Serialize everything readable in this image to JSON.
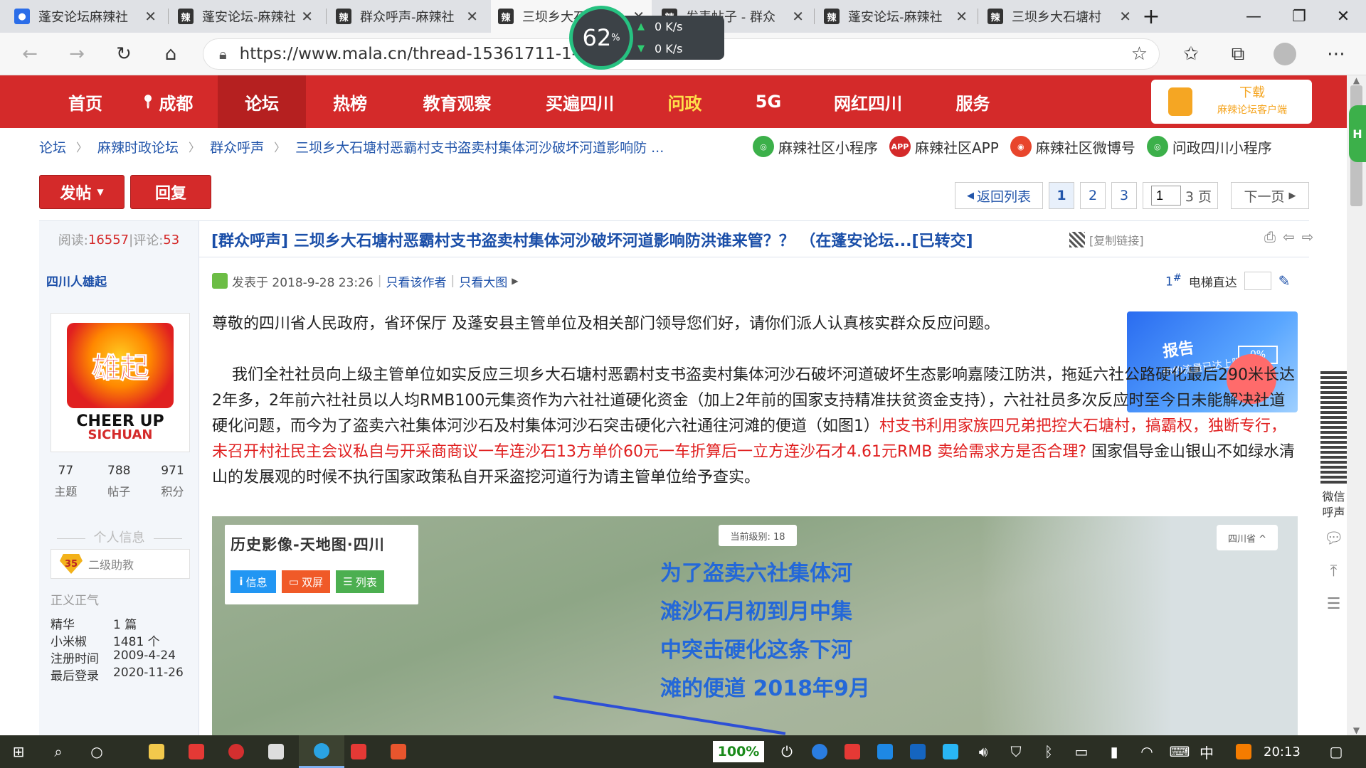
{
  "browser": {
    "tabs": [
      {
        "title": "蓬安论坛麻辣社",
        "favicon": "baidu-paw-icon",
        "active": false
      },
      {
        "title": "蓬安论坛-麻辣社",
        "favicon": "mala-logo-icon",
        "active": false
      },
      {
        "title": "群众呼声-麻辣社",
        "favicon": "mala-logo-icon",
        "active": false
      },
      {
        "title": "三坝乡大石塘",
        "favicon": "mala-logo-icon",
        "active": true
      },
      {
        "title": "发表帖子 - 群众",
        "favicon": "mala-logo-icon",
        "active": false
      },
      {
        "title": "蓬安论坛-麻辣社",
        "favicon": "mala-logo-icon",
        "active": false
      },
      {
        "title": "三坝乡大石塘村",
        "favicon": "mala-logo-icon",
        "active": false
      }
    ],
    "url": "https://www.mala.cn/thread-15361711-1-2.html"
  },
  "speed_widget": {
    "percent": "62",
    "percent_unit": "%",
    "upload": "0",
    "download": "0",
    "unit": "K/s"
  },
  "site_nav": {
    "items": [
      "首页",
      "成都",
      "论坛",
      "热榜",
      "教育观察",
      "买遍四川",
      "问政",
      "5G",
      "网红四川",
      "服务"
    ],
    "active": "论坛",
    "download_title": "下载",
    "download_sub": "麻辣论坛客户端"
  },
  "breadcrumb": [
    "论坛",
    "麻辣时政论坛",
    "群众呼声",
    "三坝乡大石塘村恶霸村支书盗卖村集体河沙破坏河道影响防 ..."
  ],
  "quick_links": [
    {
      "label": "麻辣社区小程序",
      "icon": "wechat-mini-program-icon",
      "badge": ""
    },
    {
      "label": "麻辣社区APP",
      "icon": "app-icon",
      "badge": "APP"
    },
    {
      "label": "麻辣社区微博号",
      "icon": "weibo-icon",
      "badge": ""
    },
    {
      "label": "问政四川小程序",
      "icon": "wechat-mini-program-icon",
      "badge": ""
    }
  ],
  "actions": {
    "post": "发帖",
    "reply": "回复"
  },
  "pagination": {
    "back": "返回列表",
    "pages": [
      "1",
      "2",
      "3"
    ],
    "current": "1",
    "input_value": "1",
    "total": "/ 3 页",
    "next": "下一页"
  },
  "thread": {
    "reads_label": "阅读:",
    "reads": "16557",
    "comments_label": "评论:",
    "comments": "53",
    "title": "[群众呼声] 三坝乡大石塘村恶霸村支书盗卖村集体河沙破坏河道影响防洪谁来管？？ （在蓬安论坛...[已转交]",
    "copy_link": "[复制链接]"
  },
  "author": {
    "name": "四川人雄起",
    "avatar_text_1": "雄起",
    "avatar_text_2": "CHEER UP",
    "avatar_text_3": "SICHUAN",
    "stats": [
      {
        "value": "77",
        "label": "主题"
      },
      {
        "value": "788",
        "label": "帖子"
      },
      {
        "value": "971",
        "label": "积分"
      }
    ],
    "info_heading": "个人信息",
    "level_badge": "35",
    "level": "二级助教",
    "motto": "正义正气",
    "rows": [
      {
        "label": "精华",
        "value": "1 篇"
      },
      {
        "label": "小米椒",
        "value": "1481 个"
      },
      {
        "label": "注册时间",
        "value": "2009-4-24"
      },
      {
        "label": "最后登录",
        "value": "2020-11-26"
      }
    ]
  },
  "post": {
    "posted_at": "发表于 2018-9-28 23:26",
    "only_author": "只看该作者",
    "only_images": "只看大图",
    "floor": "1",
    "floor_suffix": "#",
    "elevator": "电梯直达",
    "para1": "尊敬的四川省人民政府，省环保厅 及蓬安县主管单位及相关部门领导您们好，请你们派人认真核实群众反应问题。",
    "para2_a": "我们全社社员向上级主管单位如实反应三坝乡大石塘村恶霸村支书盗卖村集体河沙石破坏河道破坏生态影响嘉陵江防洪，拖延六社公路硬化最后290米长达2年多，2年前六社社员以人均RMB100元集资作为六社社道硬化资金（加上2年前的国家支持精准扶贫资金支持），六社社员多次反应时至今日未能解决社道硬化问题，而今为了盗卖六社集体河沙石及村集体河沙石突击硬化六社通往河滩的便道（如图1）",
    "para2_red": "村支书利用家族四兄弟把控大石塘村，搞霸权，独断专行，未召开村社民主会议私自与开采商商议一车连沙石13方单价60元一车折算后一立方连沙石才4.61元RMB 卖给需求方是否合理?",
    "para2_b": " 国家倡导金山银山不如绿水清山的发展观的时候不执行国家政策私自开采盗挖河道行为请主管单位给予查实。"
  },
  "ad": {
    "big": "报告",
    "small": "你的流量已达上限!",
    "percent": "0%"
  },
  "map_image": {
    "panel_title": "历史影像-天地图·四川",
    "buttons": [
      "信息",
      "双屏",
      "列表"
    ],
    "level": "当前级别: 18",
    "province": "四川省 ^",
    "note_lines": [
      "为了盗卖六社集体河",
      "滩沙石月初到月中集",
      "中突击硬化这条下河",
      "滩的便道  2018年9月"
    ]
  },
  "right_tools": {
    "label": "微信\n呼声"
  },
  "edge_fab": "H",
  "taskbar": {
    "battery": "100%",
    "ime": "中",
    "time": "20:13"
  }
}
